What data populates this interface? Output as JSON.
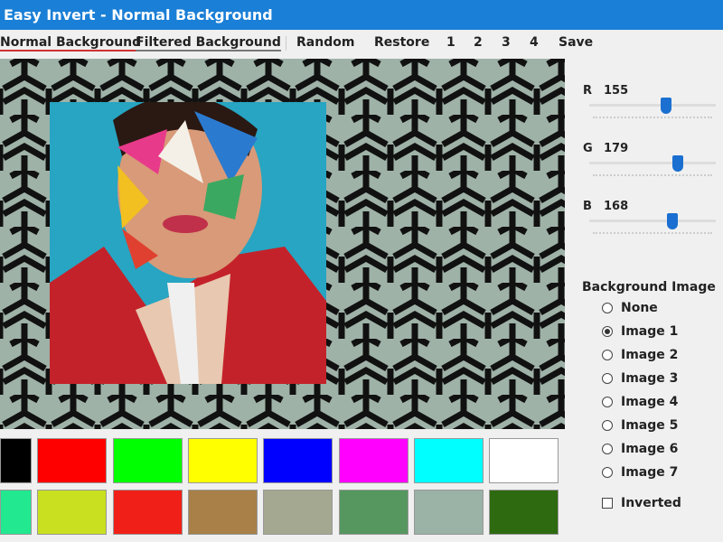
{
  "window": {
    "title": "Easy Invert - Normal Background"
  },
  "menu": {
    "normal": "Normal Background",
    "filtered": "Filtered Background",
    "random": "Random",
    "restore": "Restore",
    "p1": "1",
    "p2": "2",
    "p3": "3",
    "p4": "4",
    "save": "Save"
  },
  "sliders": [
    {
      "label": "R",
      "value": 155
    },
    {
      "label": "G",
      "value": 179
    },
    {
      "label": "B",
      "value": 168
    }
  ],
  "slider_max": 255,
  "background": {
    "title": "Background Image",
    "options": [
      "None",
      "Image 1",
      "Image 2",
      "Image 3",
      "Image 4",
      "Image 5",
      "Image 6",
      "Image 7"
    ],
    "selected": 1,
    "inverted_label": "Inverted",
    "inverted": false
  },
  "swatches": [
    [
      "#000000",
      "#ff0000",
      "#00ff00",
      "#ffff00",
      "#0000ff",
      "#ff00ff",
      "#00ffff",
      "#ffffff"
    ],
    [
      "#22e890",
      "#c8e020",
      "#f02018",
      "#a88048",
      "#a4a890",
      "#55975f",
      "#9bb2a6",
      "#2e6a10"
    ]
  ]
}
